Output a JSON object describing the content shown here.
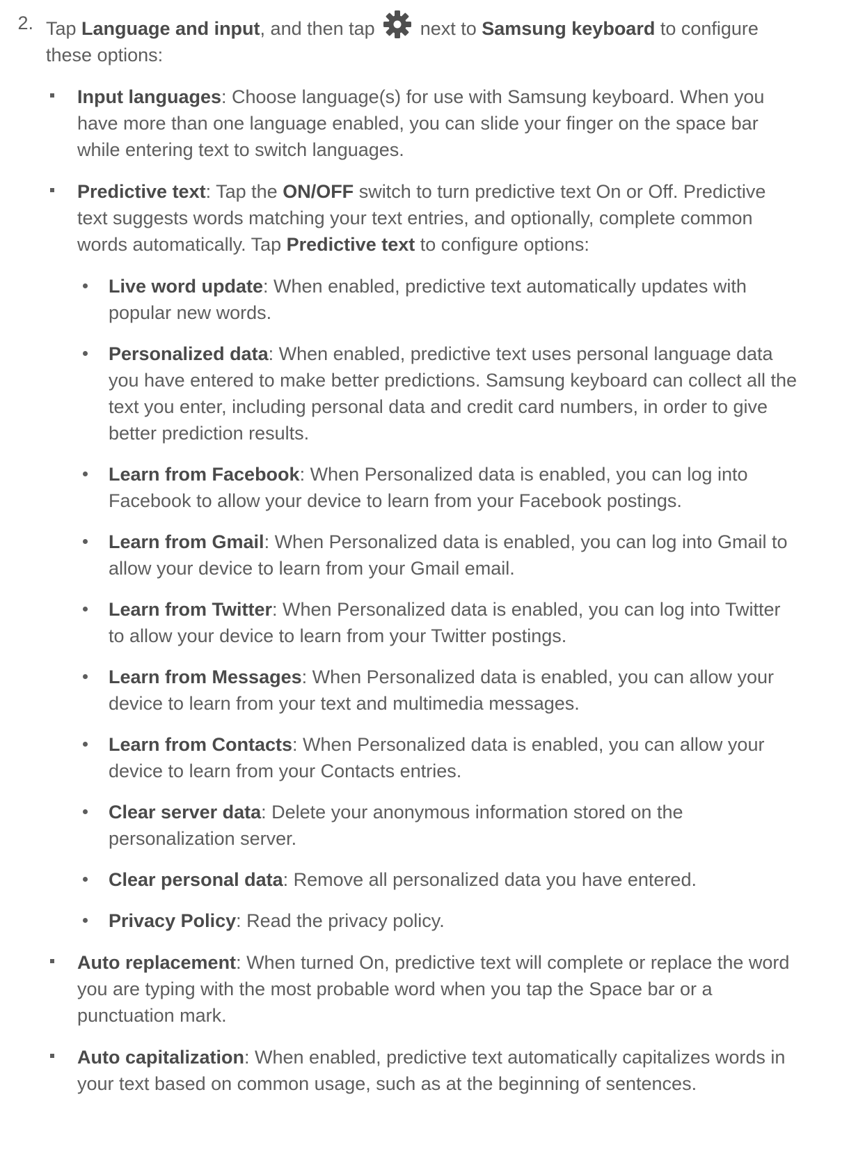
{
  "step": {
    "number": "2.",
    "intro_1": "Tap ",
    "intro_b1": "Language and input",
    "intro_2": ", and then tap ",
    "gear_icon": "gear-icon",
    "intro_3": " next to ",
    "intro_b2": "Samsung keyboard",
    "intro_4": " to configure these options:"
  },
  "options": [
    {
      "title": "Input languages",
      "text": ": Choose language(s) for use with Samsung keyboard. When you have more than one language enabled, you can slide your finger on the space bar while entering text to switch languages."
    },
    {
      "title": "Predictive text",
      "text_1": ": Tap the ",
      "bold_1": "ON/OFF",
      "text_2": " switch to turn predictive text On or Off. Predictive text suggests words matching your text entries, and optionally, complete common words automatically. Tap ",
      "bold_2": "Predictive text",
      "text_3": " to configure options:",
      "sub": [
        {
          "title": "Live word update",
          "text": ": When enabled, predictive text automatically updates with popular new words."
        },
        {
          "title": "Personalized data",
          "text": ": When enabled, predictive text uses personal language data you have entered to make better predictions. Samsung keyboard can collect all the text you enter, including personal data and credit card numbers, in order to give better prediction results."
        },
        {
          "title": "Learn from Facebook",
          "text": ": When Personalized data is enabled, you can log into Facebook to allow your device to learn from your Facebook postings."
        },
        {
          "title": "Learn from Gmail",
          "text": ": When Personalized data is enabled, you can log into Gmail to allow your device to learn from your Gmail email."
        },
        {
          "title": "Learn from Twitter",
          "text": ": When Personalized data is enabled, you can log into Twitter to allow your device to learn from your Twitter postings."
        },
        {
          "title": "Learn from Messages",
          "text": ": When Personalized data is enabled, you can allow your device to learn from your text and multimedia messages."
        },
        {
          "title": "Learn from Contacts",
          "text": ": When Personalized data is enabled, you can allow your device to learn from your Contacts entries."
        },
        {
          "title": "Clear server data",
          "text": ": Delete your anonymous information stored on the personalization server."
        },
        {
          "title": "Clear personal data",
          "text": ": Remove all personalized data you have entered."
        },
        {
          "title": "Privacy Policy",
          "text": ": Read the privacy policy."
        }
      ]
    },
    {
      "title": "Auto replacement",
      "text": ": When turned On, predictive text will complete or replace the word you are typing with the most probable word when you tap the Space bar or a punctuation mark."
    },
    {
      "title": "Auto capitalization",
      "text": ": When enabled, predictive text automatically capitalizes words in your text based on common usage, such as at the beginning of sentences."
    }
  ]
}
